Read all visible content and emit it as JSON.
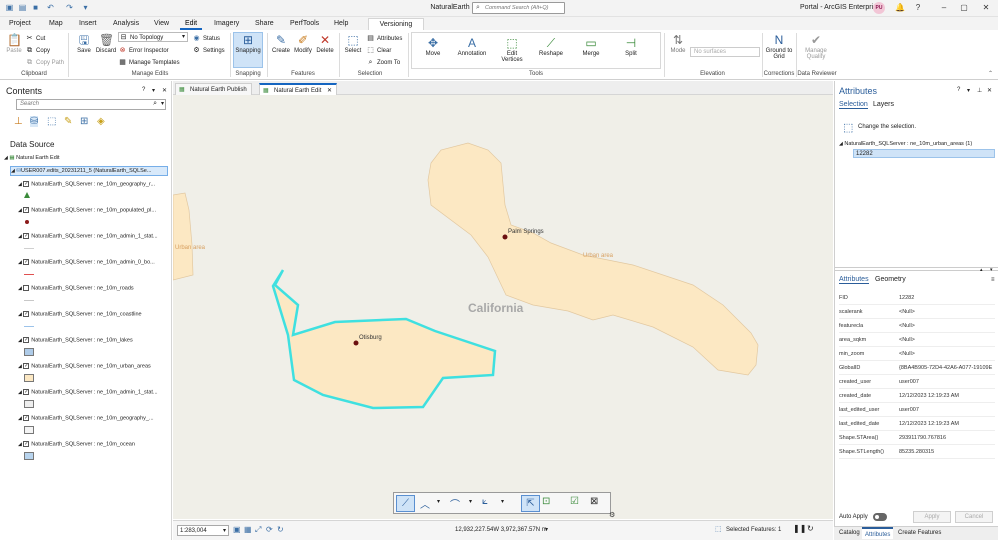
{
  "app": {
    "title": "NaturalEarth",
    "command_search_placeholder": "Command Search (Alt+Q)",
    "portal_label": "Portal - ArcGIS Enterprise",
    "user_initials": "PU"
  },
  "ribbon_tabs": [
    "Project",
    "Map",
    "Insert",
    "Analysis",
    "View",
    "Edit",
    "Imagery",
    "Share",
    "PerfTools",
    "Help",
    "Versioning"
  ],
  "ribbon": {
    "clipboard": {
      "paste": "Paste",
      "cut": "Cut",
      "copy": "Copy",
      "copy_path": "Copy Path",
      "label": "Clipboard"
    },
    "manage_edits": {
      "save": "Save",
      "discard": "Discard",
      "topology": "No Topology",
      "error_inspector": "Error Inspector",
      "manage_templates": "Manage Templates",
      "status": "Status",
      "settings": "Settings",
      "label": "Manage Edits"
    },
    "snapping": {
      "snapping": "Snapping",
      "label": "Snapping"
    },
    "features": {
      "create": "Create",
      "modify": "Modify",
      "delete": "Delete",
      "label": "Features"
    },
    "selection": {
      "select": "Select",
      "attributes": "Attributes",
      "clear": "Clear",
      "zoom_to": "Zoom To",
      "label": "Selection"
    },
    "tools": {
      "move": "Move",
      "annotation": "Annotation",
      "edit_vertices": "Edit Vertices",
      "reshape": "Reshape",
      "merge": "Merge",
      "split": "Split",
      "label": "Tools"
    },
    "elevation": {
      "mode": "Mode",
      "surface": "No surfaces",
      "label": "Elevation"
    },
    "corrections": {
      "ground_to_grid": "Ground to Grid",
      "label": "Corrections"
    },
    "data_reviewer": {
      "manage_quality": "Manage Quality",
      "label": "Data Reviewer"
    }
  },
  "contents": {
    "title": "Contents",
    "search_placeholder": "Search",
    "section": "Data Source",
    "map_name": "Natural Earth Edit",
    "version_item": "USER007.edits_20231211_5 (NaturalEarth_SQLSe...",
    "layers": [
      {
        "name": "NaturalEarth_SQLServer : ne_10m_geography_r...",
        "checked": true
      },
      {
        "name": "NaturalEarth_SQLServer : ne_10m_populated_pl...",
        "checked": true
      },
      {
        "name": "NaturalEarth_SQLServer : ne_10m_admin_1_stat...",
        "checked": true
      },
      {
        "name": "NaturalEarth_SQLServer : ne_10m_admin_0_bo...",
        "checked": true
      },
      {
        "name": "NaturalEarth_SQLServer : ne_10m_roads",
        "checked": false
      },
      {
        "name": "NaturalEarth_SQLServer : ne_10m_coastline",
        "checked": true
      },
      {
        "name": "NaturalEarth_SQLServer : ne_10m_lakes",
        "checked": true
      },
      {
        "name": "NaturalEarth_SQLServer : ne_10m_urban_areas",
        "checked": true
      },
      {
        "name": "NaturalEarth_SQLServer : ne_10m_admin_1_stat...",
        "checked": true
      },
      {
        "name": "NaturalEarth_SQLServer : ne_10m_geography_...",
        "checked": true
      },
      {
        "name": "NaturalEarth_SQLServer : ne_10m_ocean",
        "checked": true
      }
    ]
  },
  "map_tabs": [
    "Natural Earth Publish",
    "Natural Earth Edit"
  ],
  "map": {
    "labels": {
      "palm_springs": "Palm Springs",
      "otisburg": "Otisburg",
      "california": "California",
      "urban_area_1": "Urban area",
      "urban_area_2": "Urban area"
    },
    "colors": {
      "background": "#f0efe8",
      "urban": "#fce8c3",
      "urban_outline": "#e2c8a0",
      "selection": "#3fe0e0"
    }
  },
  "status": {
    "scale": "1:283,004",
    "coordinates": "12,932,227.54W 3,972,367.57N m",
    "selected_features": "Selected Features: 1"
  },
  "attributes_pane": {
    "title": "Attributes",
    "tab_selection": "Selection",
    "tab_layers": "Layers",
    "hint": "Change the selection.",
    "layer_node": "NaturalEarth_SQLServer : ne_10m_urban_areas (1)",
    "selected_id": "12282",
    "tab_attributes": "Attributes",
    "tab_geometry": "Geometry",
    "fields": [
      {
        "k": "FID",
        "v": "12282"
      },
      {
        "k": "scalerank",
        "v": "<Null>"
      },
      {
        "k": "featurecla",
        "v": "<Null>"
      },
      {
        "k": "area_sqkm",
        "v": "<Null>"
      },
      {
        "k": "min_zoom",
        "v": "<Null>"
      },
      {
        "k": "GlobalID",
        "v": "{8BA4B905-72D4-42A6-A077-19109E"
      },
      {
        "k": "created_user",
        "v": "user007"
      },
      {
        "k": "created_date",
        "v": "12/12/2023 12:19:23 AM"
      },
      {
        "k": "last_edited_user",
        "v": "user007"
      },
      {
        "k": "last_edited_date",
        "v": "12/12/2023 12:19:23 AM"
      },
      {
        "k": "Shape.STArea()",
        "v": "293911790.767816"
      },
      {
        "k": "Shape.STLength()",
        "v": "85235.280315"
      }
    ],
    "auto_apply": "Auto Apply",
    "apply": "Apply",
    "cancel": "Cancel"
  },
  "bottom_tabs": [
    "Catalog",
    "Attributes",
    "Create Features"
  ]
}
